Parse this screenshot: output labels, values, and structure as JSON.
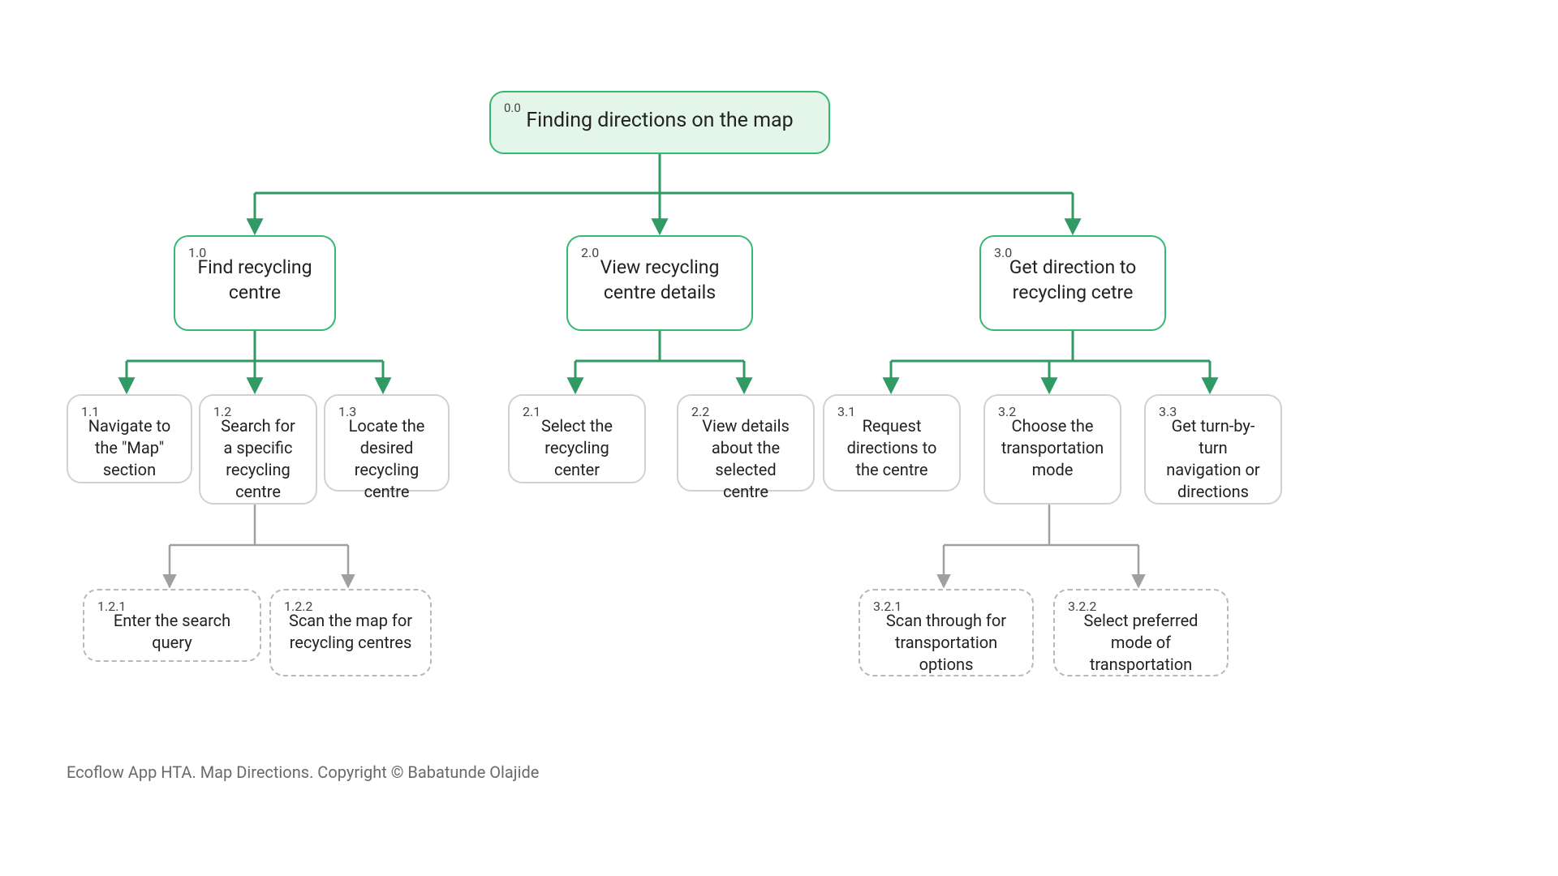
{
  "root": {
    "num": "0.0",
    "label": "Finding directions on the map"
  },
  "l1": {
    "n1": {
      "num": "1.0",
      "label": "Find recycling centre"
    },
    "n2": {
      "num": "2.0",
      "label": "View recycling centre details"
    },
    "n3": {
      "num": "3.0",
      "label": "Get direction to recycling cetre"
    }
  },
  "l2": {
    "n11": {
      "num": "1.1",
      "label": "Navigate to the \"Map\" section"
    },
    "n12": {
      "num": "1.2",
      "label": "Search for a specific recycling centre"
    },
    "n13": {
      "num": "1.3",
      "label": "Locate the desired recycling centre"
    },
    "n21": {
      "num": "2.1",
      "label": "Select the recycling center"
    },
    "n22": {
      "num": "2.2",
      "label": "View details about the selected centre"
    },
    "n31": {
      "num": "3.1",
      "label": "Request directions to the centre"
    },
    "n32": {
      "num": "3.2",
      "label": "Choose the transportation mode"
    },
    "n33": {
      "num": "3.3",
      "label": "Get turn-by-turn navigation or directions"
    }
  },
  "l3": {
    "n121": {
      "num": "1.2.1",
      "label": "Enter the search query"
    },
    "n122": {
      "num": "1.2.2",
      "label": "Scan the map for recycling centres"
    },
    "n321": {
      "num": "3.2.1",
      "label": "Scan through for transportation options"
    },
    "n322": {
      "num": "3.2.2",
      "label": "Select preferred mode of transportation"
    }
  },
  "footer": "Ecoflow App HTA. Map Directions. Copyright ©  Babatunde Olajide",
  "colors": {
    "green": "#2f9a63",
    "grey": "#a0a0a0"
  }
}
